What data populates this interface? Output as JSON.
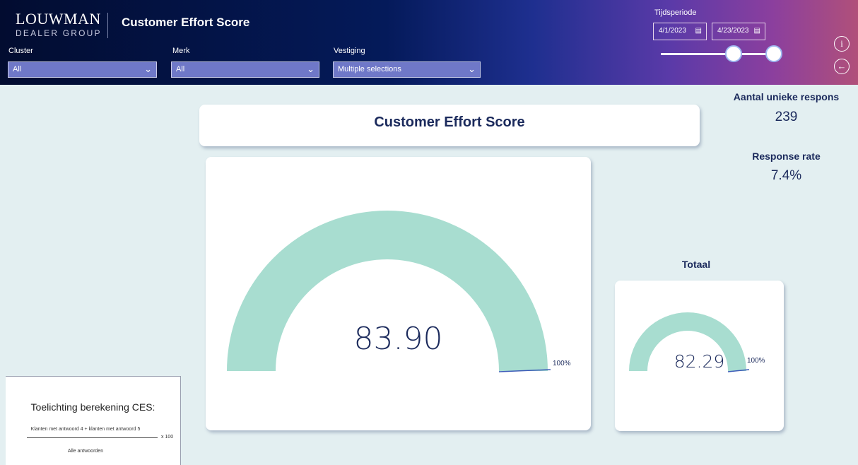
{
  "header": {
    "logo_main": "LOUWMAN",
    "logo_sub": "DEALER GROUP",
    "title": "Customer Effort Score",
    "filters": [
      {
        "label": "Cluster",
        "value": "All"
      },
      {
        "label": "Merk",
        "value": "All"
      },
      {
        "label": "Vestiging",
        "value": "Multiple selections"
      }
    ],
    "period": {
      "label": "Tijdsperiode",
      "start": "4/1/2023",
      "end": "4/23/2023",
      "slider_start_fraction": 0.75,
      "slider_end_fraction": 1.0
    },
    "info_icon": "info-icon",
    "back_icon": "back-arrow-icon"
  },
  "main": {
    "title": "Customer Effort Score",
    "gauge": {
      "value": "83.90",
      "max_label": "100%",
      "value_num": 83.9,
      "min": 0,
      "max": 100
    },
    "totaal": {
      "label": "Totaal",
      "value": "82.29",
      "max_label": "100%",
      "value_num": 82.29,
      "min": 0,
      "max": 100
    },
    "kpis": [
      {
        "label": "Aantal unieke respons",
        "value": "239"
      },
      {
        "label": "Response rate",
        "value": "7.4%"
      }
    ],
    "explanation": {
      "title": "Toelichting berekening CES:",
      "numerator": "Klanten met antwoord 4 + klanten met antwoord 5",
      "multiplier": "x 100",
      "denominator": "Alle antwoorden"
    }
  },
  "colors": {
    "gauge_fill": "#a8ddd0",
    "gauge_target": "#3d5bb8",
    "text_dark": "#1b2a5c",
    "background": "#e3eff1"
  }
}
